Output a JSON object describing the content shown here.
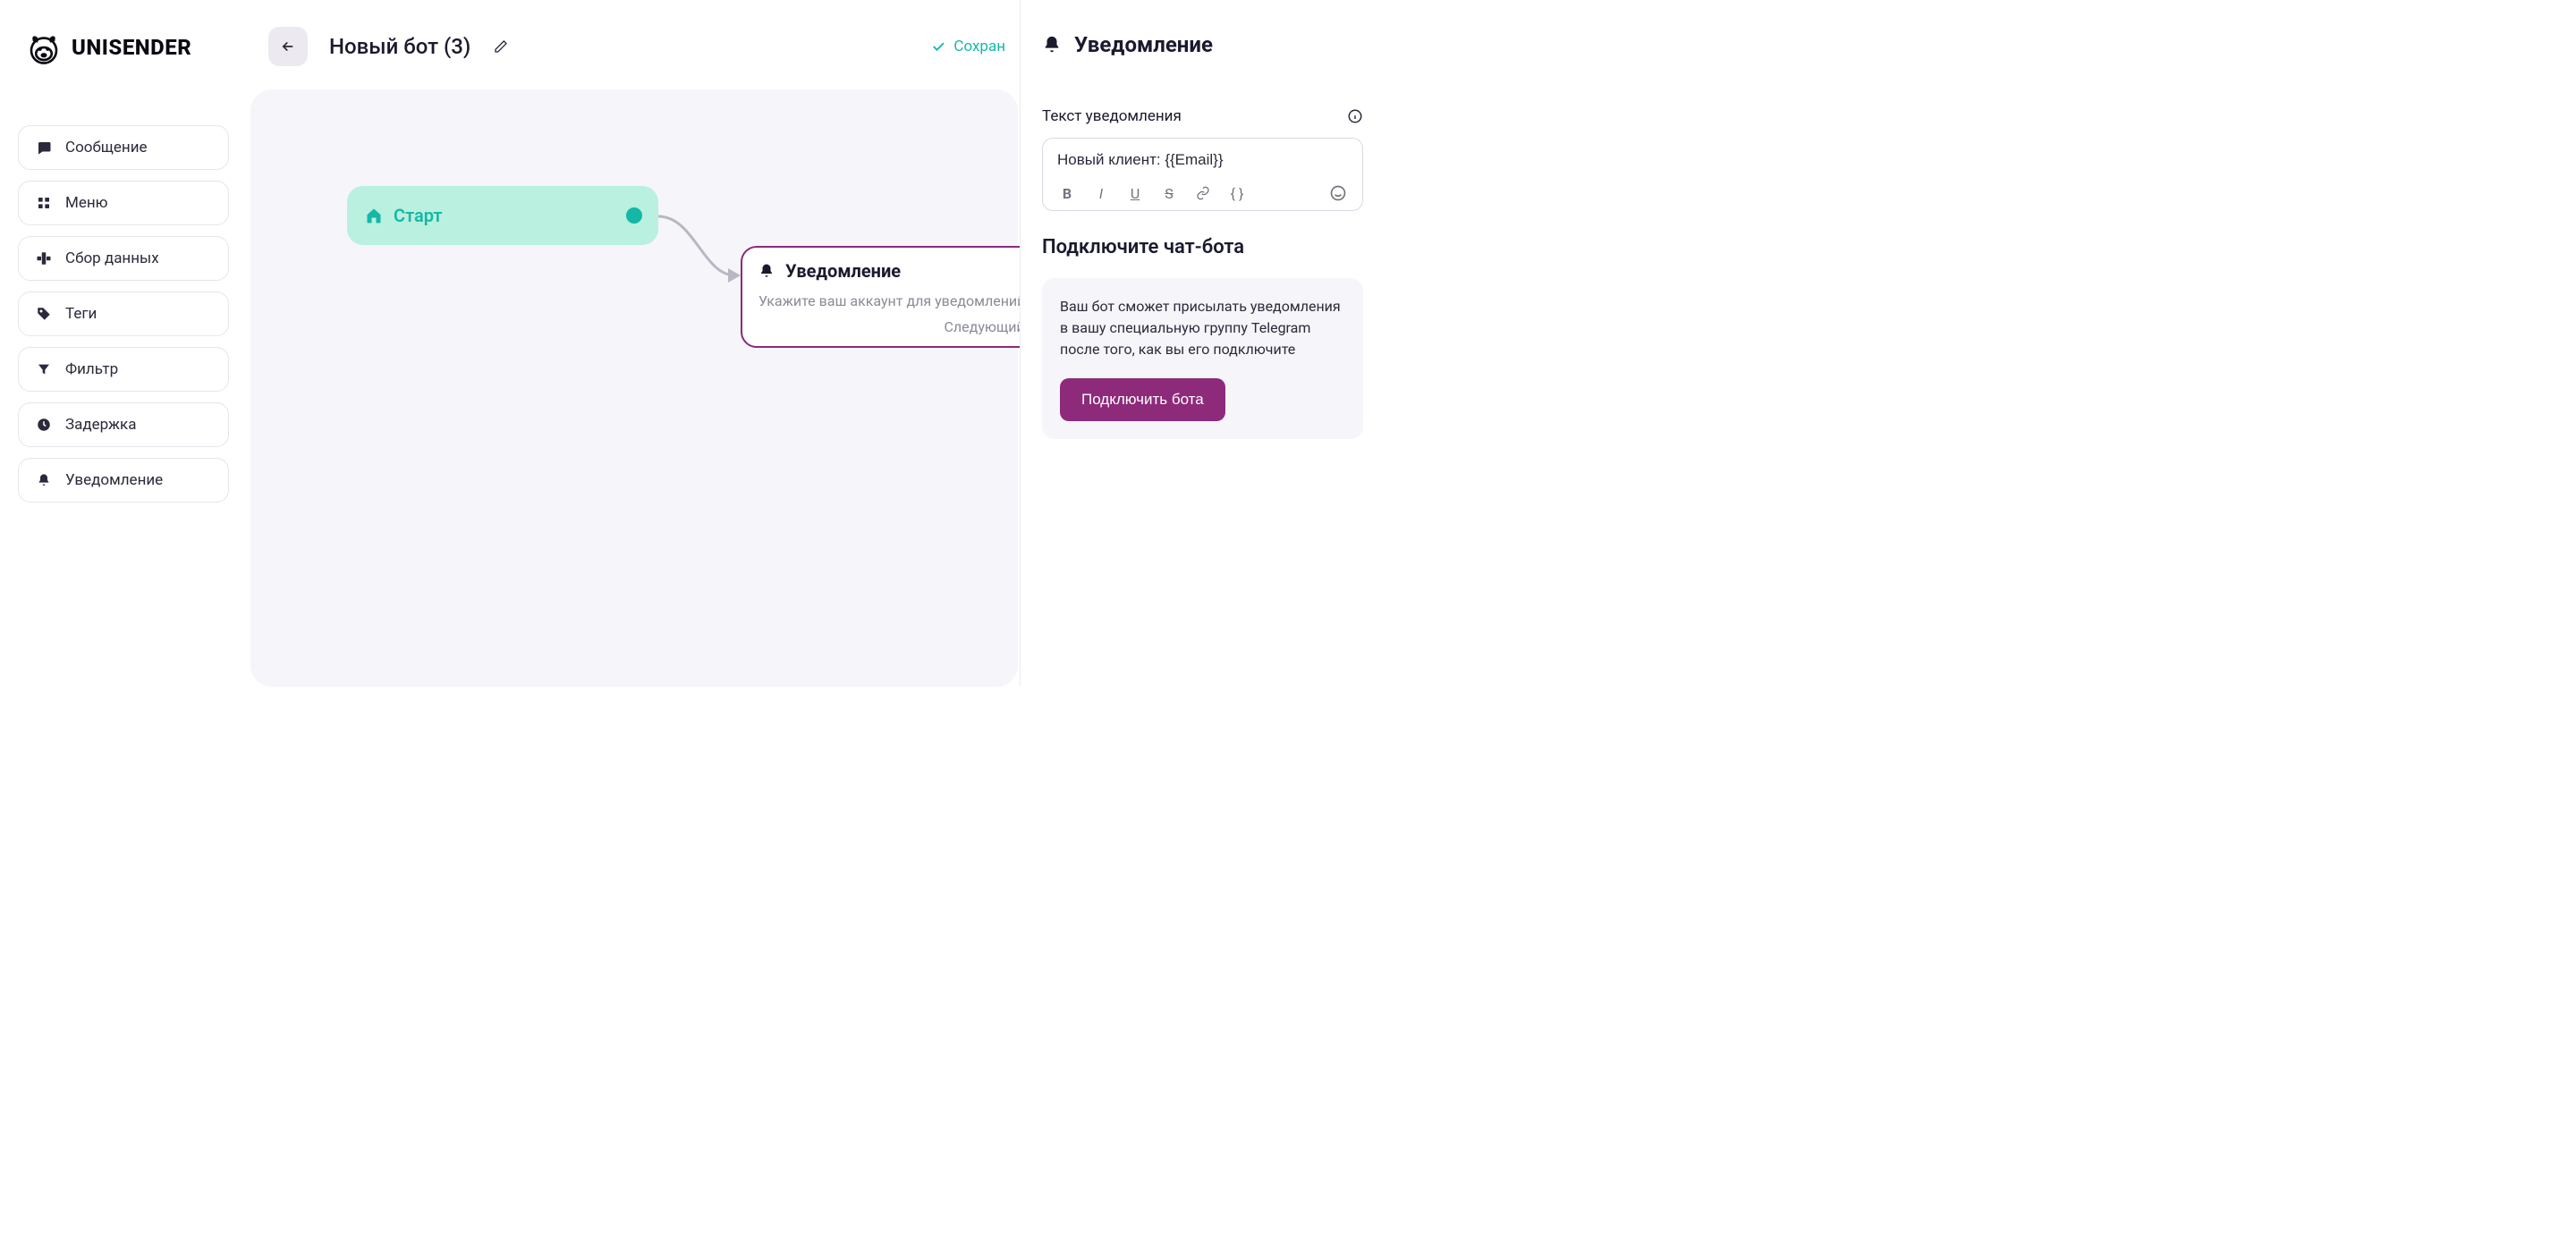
{
  "brand": "UNISENDER",
  "header": {
    "title": "Новый бот (3)",
    "save_status": "Сохран"
  },
  "palette": [
    {
      "label": "Сообщение",
      "icon": "message"
    },
    {
      "label": "Меню",
      "icon": "grid"
    },
    {
      "label": "Сбор данных",
      "icon": "form"
    },
    {
      "label": "Теги",
      "icon": "tag"
    },
    {
      "label": "Фильтр",
      "icon": "filter"
    },
    {
      "label": "Задержка",
      "icon": "clock"
    },
    {
      "label": "Уведомление",
      "icon": "bell"
    }
  ],
  "canvas": {
    "start_label": "Старт",
    "notify": {
      "title": "Уведомление",
      "hint": "Укажите ваш аккаунт для уведомлений",
      "next": "Следующий шаг"
    }
  },
  "rpanel": {
    "title": "Уведомление",
    "text_label": "Текст уведомления",
    "text_value": "Новый клиент: {{Email}}",
    "connect_heading": "Подключите чат-бота",
    "connect_desc": "Ваш бот сможет присылать уведомления в вашу специальную группу Telegram после того, как вы его подключите",
    "connect_btn": "Подключить бота"
  }
}
